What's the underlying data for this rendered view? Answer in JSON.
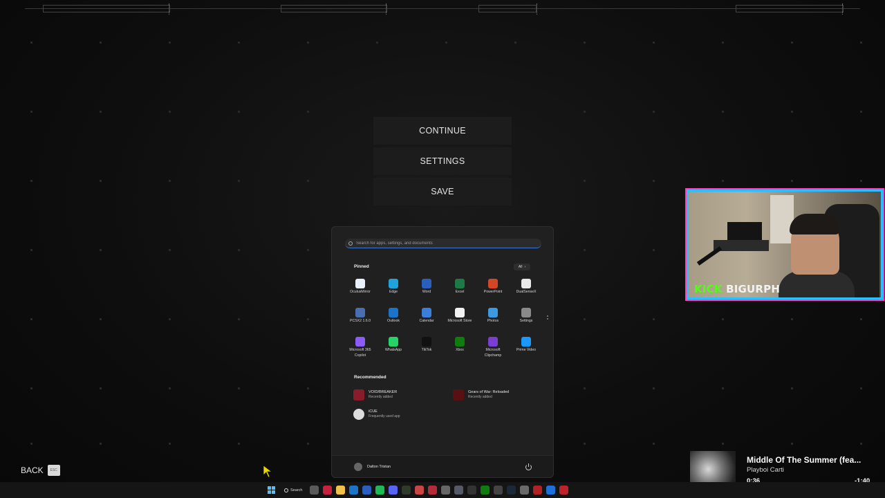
{
  "pause_menu": {
    "continue_label": "CONTINUE",
    "settings_label": "SETTINGS",
    "save_label": "SAVE",
    "back_label": "BACK",
    "back_key": "ESC"
  },
  "start_menu": {
    "search_placeholder": "Search for apps, settings, and documents",
    "pinned_title": "Pinned",
    "all_label": "All",
    "pinned_apps": [
      {
        "label": "OculusMirror",
        "icon": "oculus-mirror-icon",
        "color": "#e9f0ff"
      },
      {
        "label": "Edge",
        "icon": "edge-icon",
        "color": "#1fa3d8"
      },
      {
        "label": "Word",
        "icon": "word-icon",
        "color": "#2b5fbd"
      },
      {
        "label": "Excel",
        "icon": "excel-icon",
        "color": "#1e7a45"
      },
      {
        "label": "PowerPoint",
        "icon": "powerpoint-icon",
        "color": "#d24726"
      },
      {
        "label": "DualSenseX",
        "icon": "dualsensex-icon",
        "color": "#e8e8e8"
      },
      {
        "label": "PCSX2 1.6.0",
        "icon": "pcsx2-icon",
        "color": "#4a6fb0"
      },
      {
        "label": "Outlook",
        "icon": "outlook-icon",
        "color": "#1c74c8"
      },
      {
        "label": "Calendar",
        "icon": "calendar-icon",
        "color": "#3b7fd8"
      },
      {
        "label": "Microsoft Store",
        "icon": "microsoft-store-icon",
        "color": "#f1f1f1"
      },
      {
        "label": "Photos",
        "icon": "photos-icon",
        "color": "#3d9ae0"
      },
      {
        "label": "Settings",
        "icon": "settings-icon",
        "color": "#8a8a8a"
      },
      {
        "label": "Microsoft 365\nCopilot",
        "icon": "copilot-icon",
        "color": "#8b5cf6"
      },
      {
        "label": "WhatsApp",
        "icon": "whatsapp-icon",
        "color": "#25d366"
      },
      {
        "label": "TikTok",
        "icon": "tiktok-icon",
        "color": "#111111"
      },
      {
        "label": "Xbox",
        "icon": "xbox-icon",
        "color": "#107c10"
      },
      {
        "label": "Microsoft\nClipchamp",
        "icon": "clipchamp-icon",
        "color": "#7a3fd0"
      },
      {
        "label": "Prime Video",
        "icon": "prime-video-icon",
        "color": "#1a98ff"
      }
    ],
    "recommended_title": "Recommended",
    "recommended": [
      {
        "name": "VOID/BREAKER",
        "sub": "Recently added",
        "icon": "voidbreaker-icon",
        "color": "#8a1c2a"
      },
      {
        "name": "Gears of War: Reloaded",
        "sub": "Recently added",
        "icon": "gears-of-war-icon",
        "color": "#5a1010"
      },
      {
        "name": "iCUE",
        "sub": "Frequently used app",
        "icon": "icue-icon",
        "color": "#dcdcdc"
      }
    ],
    "user_name": "Dalton Tristan"
  },
  "webcam": {
    "kick_label": "KICK",
    "channel_name": "BIGURPH"
  },
  "now_playing": {
    "title": "Middle Of The Summer (fea...",
    "artist": "Playboi Carti",
    "elapsed": "0:36",
    "remaining": "-1:40",
    "progress": 0.26
  },
  "taskbar": {
    "search_label": "Search",
    "apps": [
      {
        "icon": "task-view-icon",
        "color": "#5a5a5a"
      },
      {
        "icon": "opera-gx-icon",
        "color": "#c8213d"
      },
      {
        "icon": "file-explorer-icon",
        "color": "#f2c14a"
      },
      {
        "icon": "outlook-icon",
        "color": "#1c74c8"
      },
      {
        "icon": "word-icon",
        "color": "#2b5fbd"
      },
      {
        "icon": "spotify-icon",
        "color": "#1db954"
      },
      {
        "icon": "discord-icon",
        "color": "#5865f2"
      },
      {
        "icon": "nvidia-icon",
        "color": "#2f3a2a"
      },
      {
        "icon": "media-icon",
        "color": "#c94444"
      },
      {
        "icon": "pin-icon",
        "color": "#b32b3b"
      },
      {
        "icon": "clock-icon",
        "color": "#666666"
      },
      {
        "icon": "monitor-icon",
        "color": "#555a66"
      },
      {
        "icon": "epic-icon",
        "color": "#333333"
      },
      {
        "icon": "xbox-icon",
        "color": "#107c10"
      },
      {
        "icon": "helmet-icon",
        "color": "#444444"
      },
      {
        "icon": "steam-icon",
        "color": "#1b2838"
      },
      {
        "icon": "app-icon",
        "color": "#6a6a6a"
      },
      {
        "icon": "game-icon",
        "color": "#b22222"
      },
      {
        "icon": "blue-app-icon",
        "color": "#1e6fd9"
      },
      {
        "icon": "red-app-icon",
        "color": "#c0222c"
      }
    ]
  }
}
